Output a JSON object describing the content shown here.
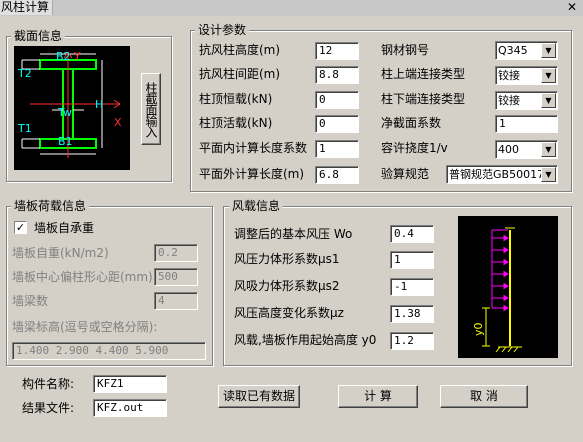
{
  "window": {
    "title": "风柱计算",
    "close": "✕"
  },
  "section": {
    "legend": "截面信息",
    "input_button": "柱截面输入",
    "diagram_labels": {
      "b2": "B2",
      "t2": "T2",
      "tw": "Tw",
      "t1": "T1",
      "b1": "B1",
      "h": "H",
      "x": "X",
      "y": "Y"
    }
  },
  "design": {
    "legend": "设计参数",
    "left": [
      {
        "label": "抗风柱高度(m)",
        "value": "12"
      },
      {
        "label": "抗风柱间距(m)",
        "value": "8.8"
      },
      {
        "label": "柱顶恒载(kN)",
        "value": "0"
      },
      {
        "label": "柱顶活载(kN)",
        "value": "0"
      },
      {
        "label": "平面内计算长度系数",
        "value": "1"
      },
      {
        "label": "平面外计算长度(m)",
        "value": "6.8"
      }
    ],
    "right": [
      {
        "label": "钢材钢号",
        "value": "Q345",
        "type": "select"
      },
      {
        "label": "柱上端连接类型",
        "value": "铰接",
        "type": "select"
      },
      {
        "label": "柱下端连接类型",
        "value": "铰接",
        "type": "select"
      },
      {
        "label": "净截面系数",
        "value": "1",
        "type": "input"
      },
      {
        "label": "容许挠度1/v",
        "value": "400",
        "type": "select"
      }
    ],
    "spec_label": "验算规范",
    "spec_value": "普钢规范GB50017"
  },
  "wall": {
    "legend": "墙板荷载信息",
    "self_bearing": "墙板自承重",
    "self_bearing_checked": true,
    "fields": [
      {
        "label": "墙板自重(kN/m2)",
        "value": "0.2"
      },
      {
        "label": "墙板中心偏柱形心距(mm)",
        "value": "500"
      },
      {
        "label": "墙梁数",
        "value": "4"
      }
    ],
    "elev_label": "墙梁标高(逗号或空格分隔):",
    "elev_value": "1.400 2.900 4.400 5.900"
  },
  "wind": {
    "legend": "风载信息",
    "fields": [
      {
        "label": "调整后的基本风压 Wo",
        "value": "0.4"
      },
      {
        "label": "风压力体形系数μs1",
        "value": "1"
      },
      {
        "label": "风吸力体形系数μs2",
        "value": "-1"
      },
      {
        "label": "风压高度变化系数μz",
        "value": "1.38"
      },
      {
        "label": "风载,墙板作用起始高度 y0",
        "value": "1.2"
      }
    ],
    "diagram_label": "y0"
  },
  "bottom": {
    "member_label": "构件名称:",
    "member_value": "KFZ1",
    "result_label": "结果文件:",
    "result_value": "KFZ.out",
    "read_button": "读取已有数据",
    "calc_button": "计 算",
    "cancel_button": "取 消"
  }
}
